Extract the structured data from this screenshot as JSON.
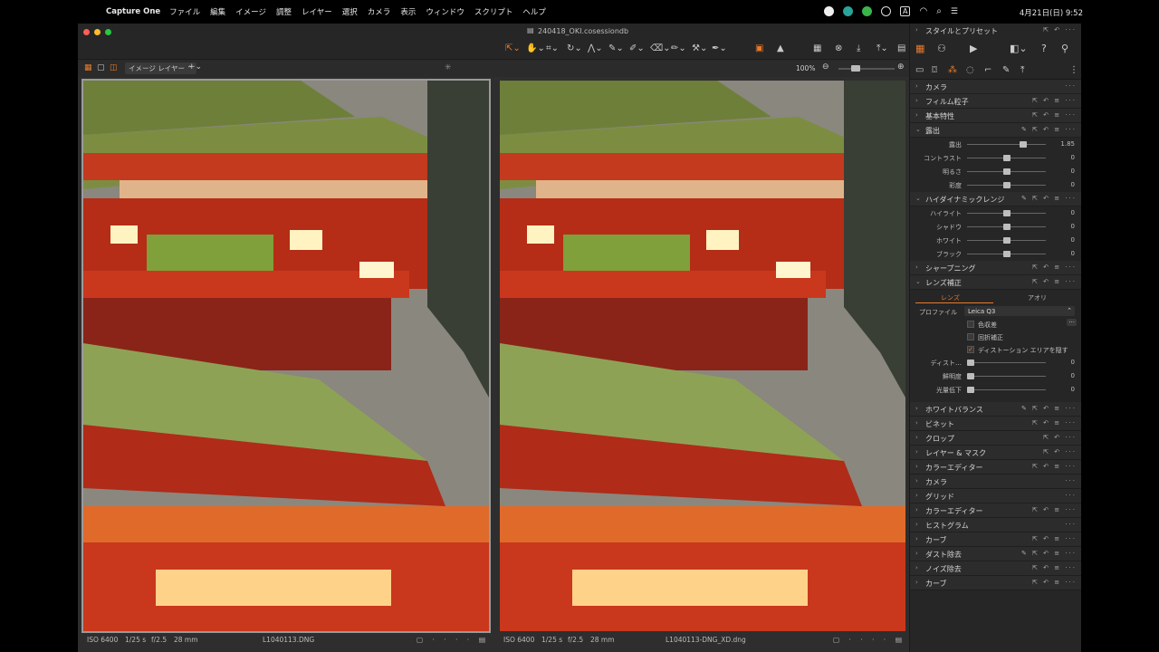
{
  "menubar": {
    "app_name": "Capture One",
    "items": [
      "ファイル",
      "編集",
      "イメージ",
      "調整",
      "レイヤー",
      "選択",
      "カメラ",
      "表示",
      "ウィンドウ",
      "スクリプト",
      "ヘルプ"
    ],
    "clock": "4月21日(日)  9:52",
    "status_icons": [
      "record-icon",
      "app-icon",
      "line-icon",
      "play-icon",
      "input-A-icon",
      "wifi-icon",
      "search-icon",
      "control-center-icon"
    ]
  },
  "window": {
    "title": "240418_OKI.cosessiondb",
    "traffic_colors": [
      "#ff5f57",
      "#febc2e",
      "#28c840"
    ]
  },
  "subbar": {
    "layer_select": "イメージ レイヤー",
    "zoom": "100%"
  },
  "viewer": {
    "left": {
      "iso": "ISO 6400",
      "shutter": "1/25 s",
      "aperture": "f/2.5",
      "focal": "28 mm",
      "filename": "L1040113.DNG"
    },
    "right": {
      "iso": "ISO 6400",
      "shutter": "1/25 s",
      "aperture": "f/2.5",
      "focal": "28 mm",
      "filename": "L1040113-DNG_XD.dng"
    }
  },
  "rpanel": {
    "header": "スタイルとプリセット",
    "tools": [
      {
        "label": "カメラ",
        "open": false
      },
      {
        "label": "フィルム粒子",
        "open": false
      },
      {
        "label": "基本特性",
        "open": false
      },
      {
        "label": "露出",
        "open": true
      }
    ],
    "exposure_sliders": [
      {
        "label": "露出",
        "value": "1.85",
        "pos": 0.72
      },
      {
        "label": "コントラスト",
        "value": "0",
        "pos": 0.5
      },
      {
        "label": "明るさ",
        "value": "0",
        "pos": 0.5
      },
      {
        "label": "彩度",
        "value": "0",
        "pos": 0.5
      }
    ],
    "hdr_label": "ハイダイナミックレンジ",
    "hdr_sliders": [
      {
        "label": "ハイライト",
        "value": "0",
        "pos": 0.5
      },
      {
        "label": "シャドウ",
        "value": "0",
        "pos": 0.5
      },
      {
        "label": "ホワイト",
        "value": "0",
        "pos": 0.5
      },
      {
        "label": "ブラック",
        "value": "0",
        "pos": 0.5
      }
    ],
    "sharpening_label": "シャープニング",
    "lens_label": "レンズ補正",
    "lens_tabs": [
      "レンズ",
      "アオリ"
    ],
    "profile_label": "プロファイル",
    "profile_value": "Leica Q3",
    "checkboxes": [
      {
        "label": "色収差",
        "checked": false
      },
      {
        "label": "回折補正",
        "checked": false
      },
      {
        "label": "ディストーション エリアを隠す",
        "checked": true
      }
    ],
    "lens_sliders": [
      {
        "label": "ディスト…",
        "value": "0",
        "pos": 0.0
      },
      {
        "label": "鮮明度",
        "value": "0",
        "pos": 0.0
      },
      {
        "label": "光量低下",
        "value": "0",
        "pos": 0.0
      }
    ],
    "more_tools": [
      "ホワイトバランス",
      "ビネット",
      "クロップ",
      "レイヤー & マスク",
      "カラーエディター",
      "カメラ",
      "グリッド",
      "カラーエディター",
      "ヒストグラム",
      "カーブ",
      "ダスト除去",
      "ノイズ除去",
      "カーブ"
    ]
  },
  "colors": {
    "accent": "#e87a2a",
    "panel_bg": "#262626",
    "viewer_bg": "#2e2e2e"
  }
}
